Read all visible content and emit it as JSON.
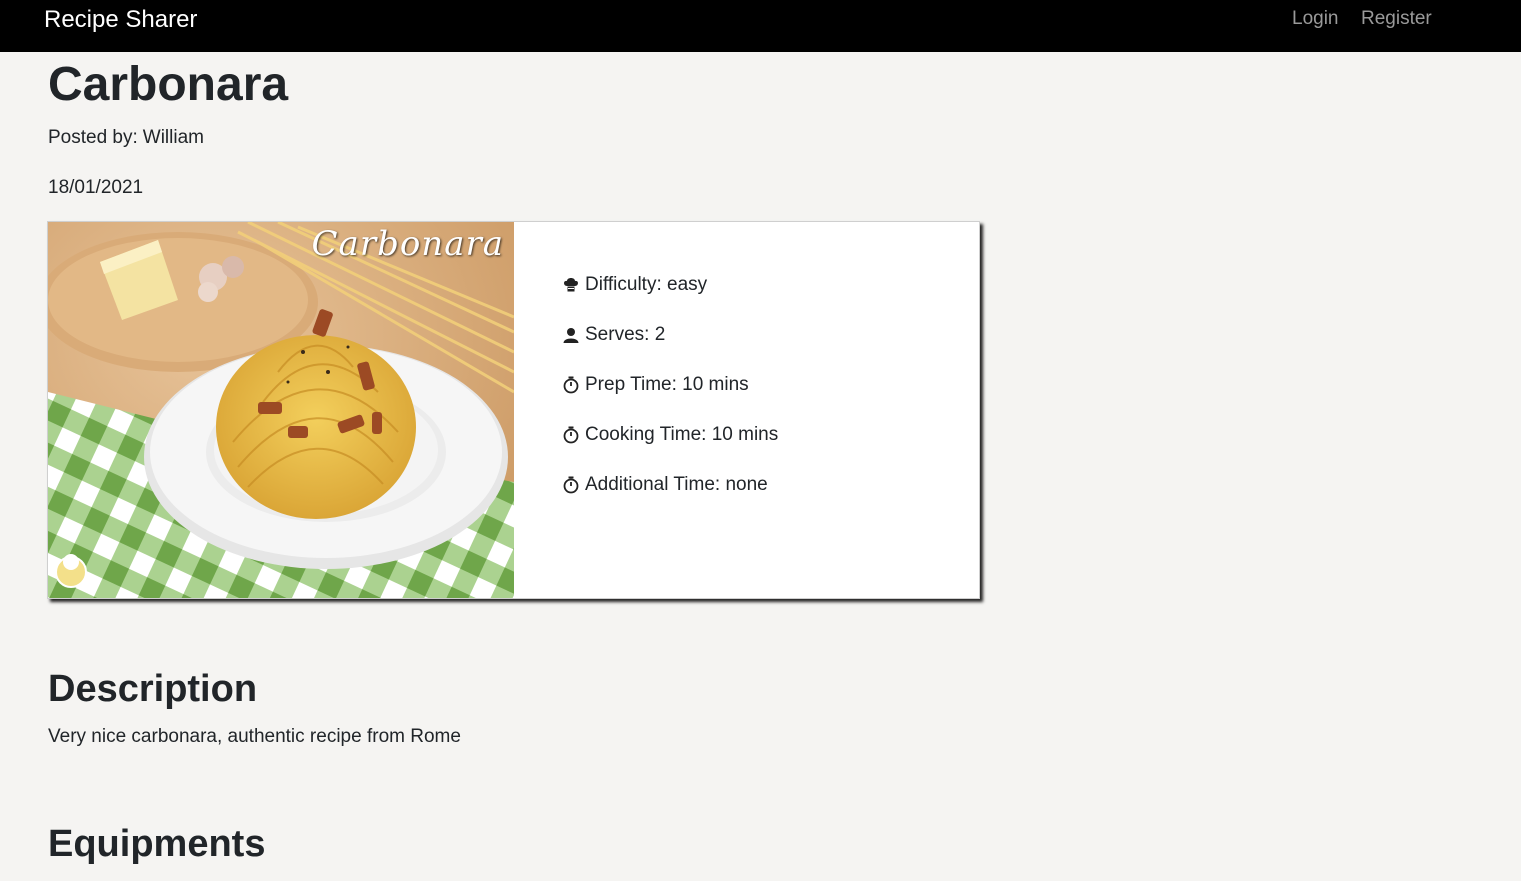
{
  "navbar": {
    "brand": "Recipe Sharer",
    "links": [
      {
        "label": "Login"
      },
      {
        "label": "Register"
      }
    ]
  },
  "recipe": {
    "title": "Carbonara",
    "posted_by_label": "Posted by:",
    "posted_by_name": "William",
    "date": "18/01/2021",
    "image_caption": "Carbonara",
    "details": [
      {
        "icon": "chef-hat-icon",
        "text": "Difficulty: easy"
      },
      {
        "icon": "user-icon",
        "text": "Serves: 2"
      },
      {
        "icon": "stopwatch-icon",
        "text": "Prep Time: 10 mins"
      },
      {
        "icon": "stopwatch-icon",
        "text": "Cooking Time: 10 mins"
      },
      {
        "icon": "stopwatch-icon",
        "text": "Additional Time: none"
      }
    ]
  },
  "sections": {
    "description_heading": "Description",
    "description_text": "Very nice carbonara, authentic recipe from Rome",
    "equipments_heading": "Equipments"
  },
  "colors": {
    "navbar_bg": "#000000",
    "page_bg": "#f5f4f2",
    "nav_link": "#9a9a9a",
    "text": "#212529"
  }
}
